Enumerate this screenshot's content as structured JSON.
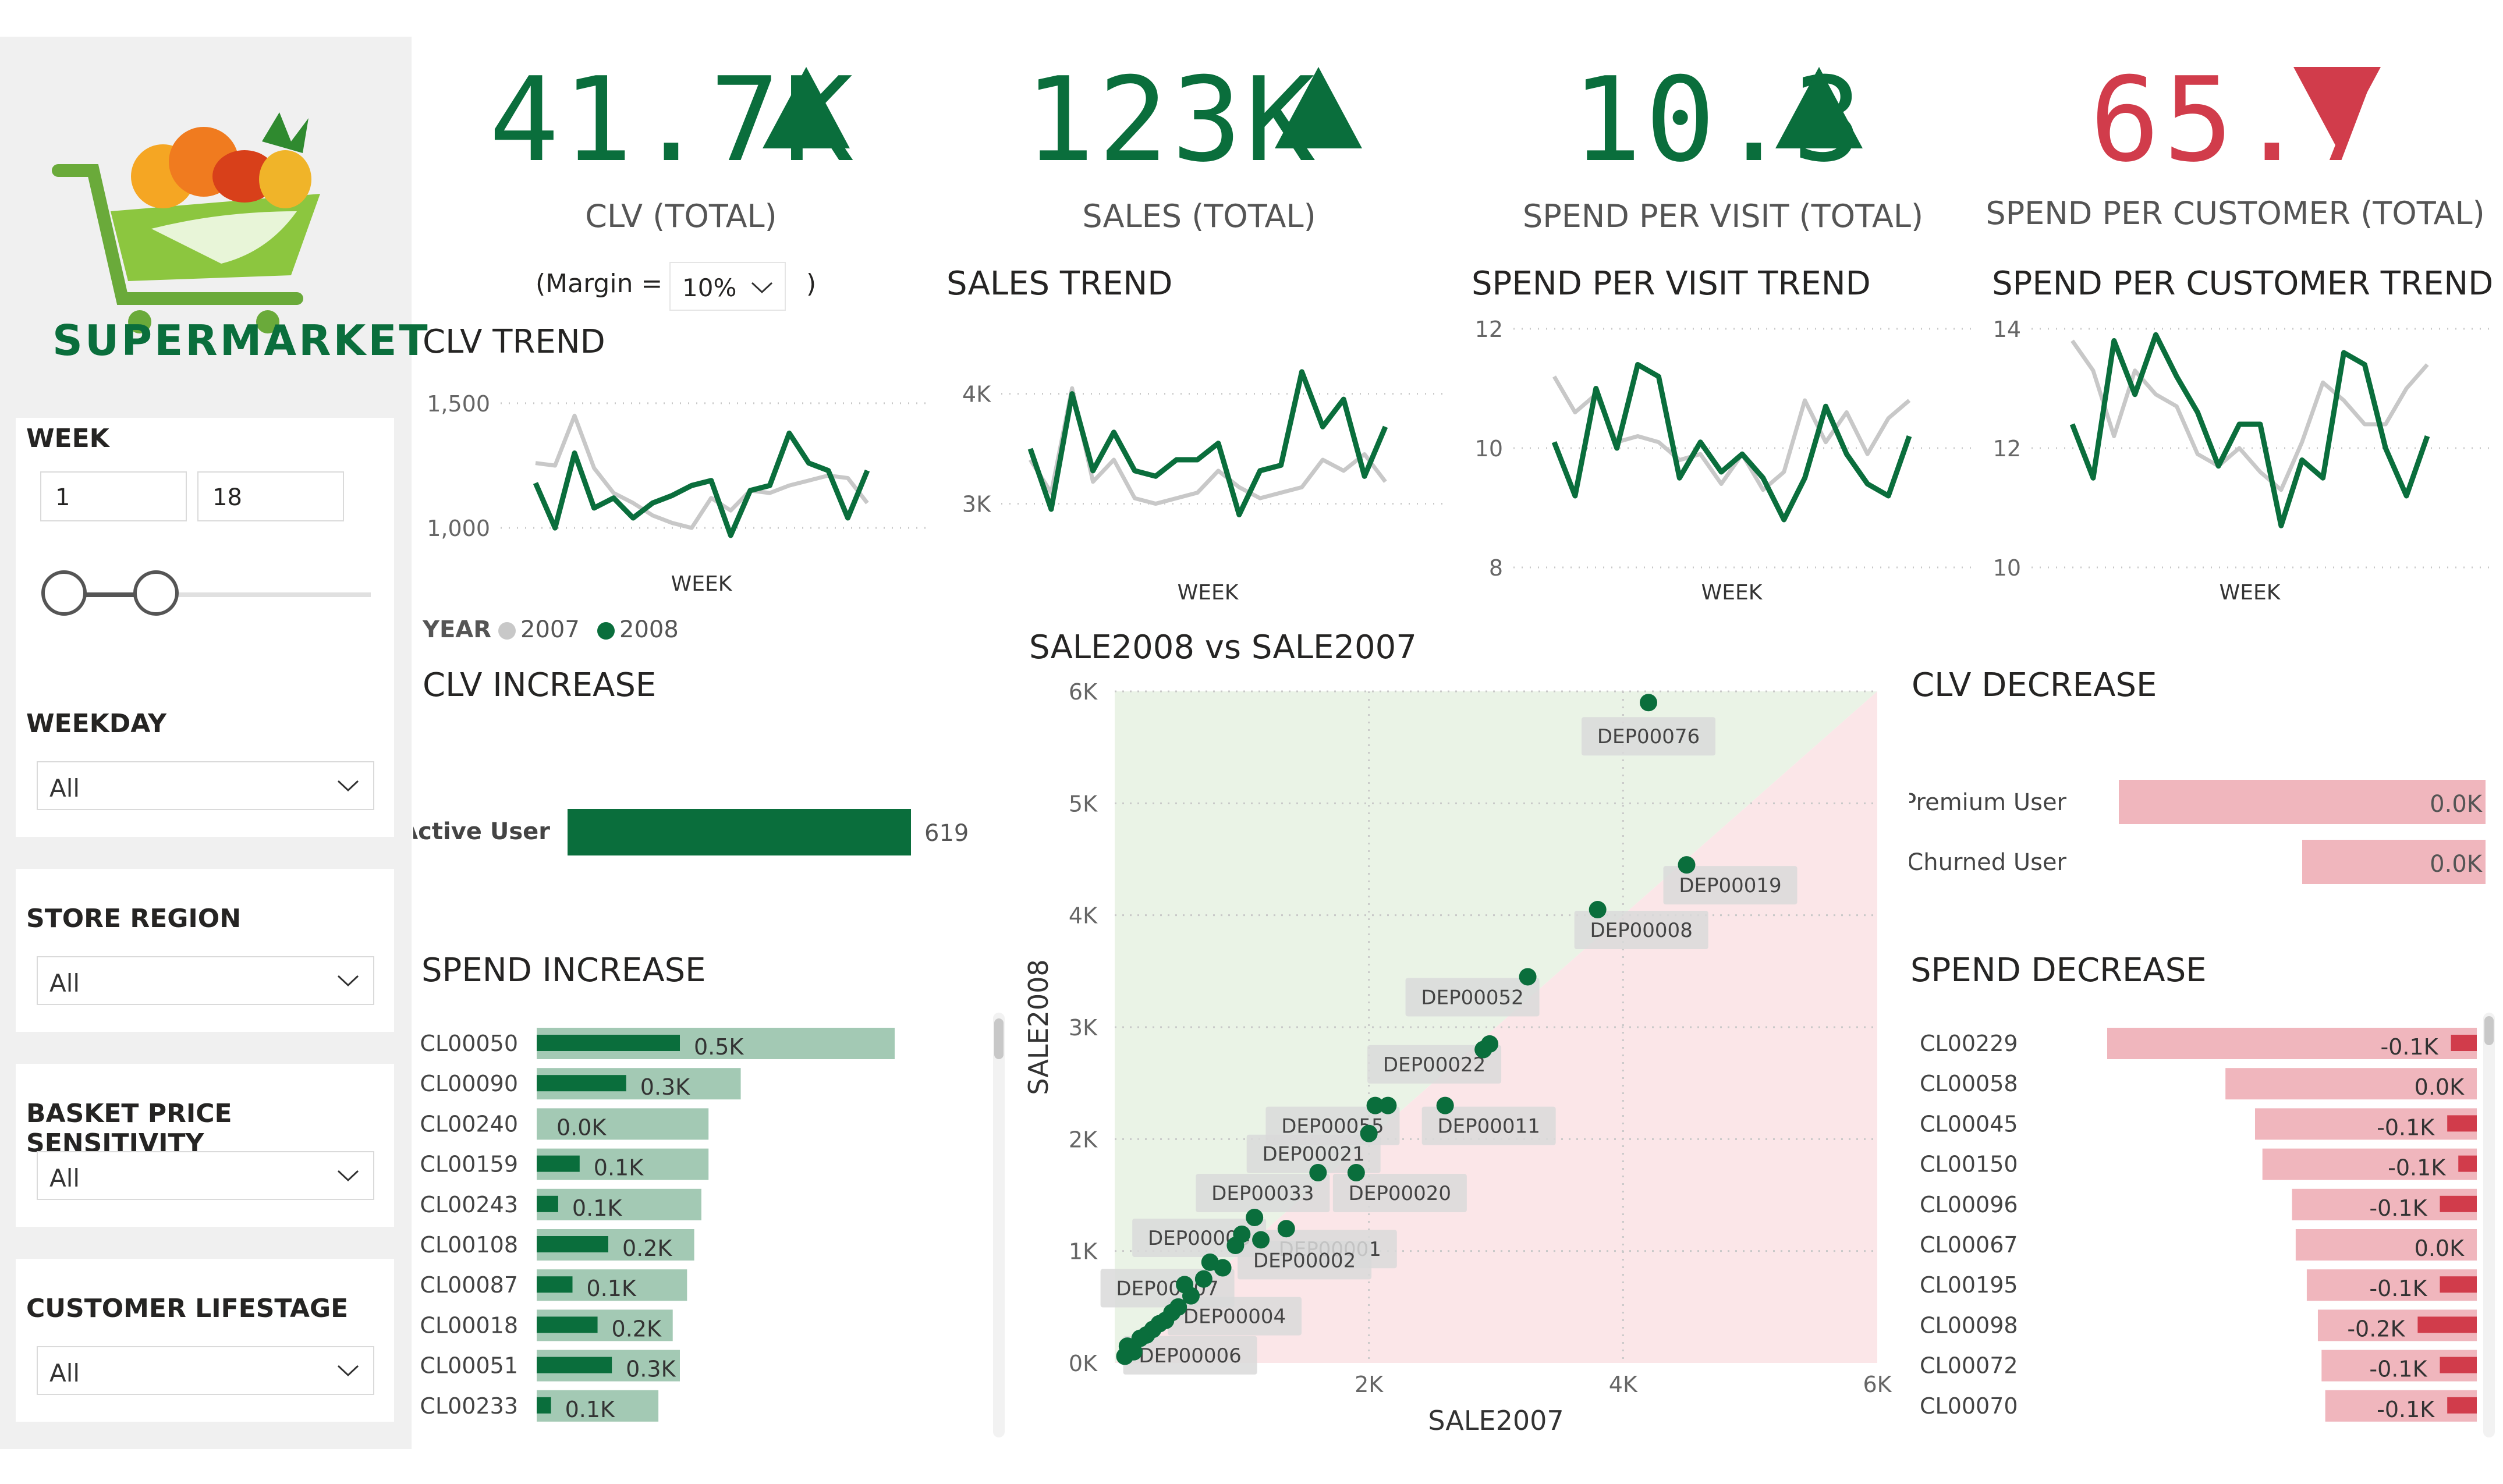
{
  "brand": {
    "name": "SUPERMARKET"
  },
  "filters": {
    "week": {
      "label": "WEEK",
      "from": "1",
      "to": "18"
    },
    "weekday": {
      "label": "WEEKDAY",
      "value": "All"
    },
    "store_region": {
      "label": "STORE REGION",
      "value": "All"
    },
    "basket_price_sensitivity": {
      "label": "BASKET PRICE SENSITIVITY",
      "value": "All"
    },
    "customer_lifestage": {
      "label": "CUSTOMER LIFESTAGE",
      "value": "All"
    }
  },
  "kpis": [
    {
      "value": "41.7K",
      "label": "CLV (TOTAL)",
      "trend": "up",
      "color": "#0a6e3c"
    },
    {
      "value": "123K",
      "label": "SALES (TOTAL)",
      "trend": "up",
      "color": "#0a6e3c"
    },
    {
      "value": "10.3",
      "label": "SPEND PER VISIT (TOTAL)",
      "trend": "up",
      "color": "#0a6e3c"
    },
    {
      "value": "65.7",
      "label": "SPEND PER CUSTOMER (TOTAL)",
      "trend": "down",
      "color": "#d13c4b"
    }
  ],
  "margin": {
    "prefix": "(Margin =",
    "value": "10%",
    "suffix": ")"
  },
  "legend": {
    "title": "YEAR",
    "items": [
      "2007",
      "2008"
    ]
  },
  "colors": {
    "y2007": "#c8c8c8",
    "y2008": "#0a6e3c",
    "pos_bg": "#a3c9b4",
    "neg_bar": "#f0b6bd",
    "neg_dark": "#d13c4b"
  },
  "chart_data": [
    {
      "type": "line",
      "title": "CLV TREND",
      "xlabel": "WEEK",
      "ylabel": "",
      "x": [
        1,
        2,
        3,
        4,
        5,
        6,
        7,
        8,
        9,
        10,
        11,
        12,
        13,
        14,
        15,
        16,
        17,
        18
      ],
      "ylim": [
        900,
        1600
      ],
      "yticks": [
        "1,000",
        "1,500"
      ],
      "series": [
        {
          "name": "2007",
          "values": [
            1260,
            1250,
            1450,
            1240,
            1140,
            1100,
            1050,
            1020,
            1000,
            1120,
            1070,
            1150,
            1140,
            1170,
            1190,
            1210,
            1200,
            1100
          ]
        },
        {
          "name": "2008",
          "values": [
            1180,
            1000,
            1300,
            1080,
            1120,
            1040,
            1100,
            1130,
            1170,
            1190,
            970,
            1150,
            1170,
            1380,
            1260,
            1230,
            1040,
            1230
          ]
        }
      ]
    },
    {
      "type": "line",
      "title": "SALES TREND",
      "xlabel": "WEEK",
      "ylabel": "",
      "x": [
        1,
        2,
        3,
        4,
        5,
        6,
        7,
        8,
        9,
        10,
        11,
        12,
        13,
        14,
        15,
        16,
        17,
        18
      ],
      "ylim": [
        2500,
        4300
      ],
      "yticks": [
        "3K",
        "4K"
      ],
      "series": [
        {
          "name": "2007",
          "values": [
            3400,
            3100,
            4050,
            3200,
            3400,
            3050,
            3000,
            3050,
            3100,
            3300,
            3150,
            3050,
            3100,
            3150,
            3400,
            3300,
            3450,
            3200
          ]
        },
        {
          "name": "2008",
          "values": [
            3500,
            2950,
            4000,
            3300,
            3650,
            3300,
            3250,
            3400,
            3400,
            3550,
            2900,
            3300,
            3350,
            4200,
            3700,
            3950,
            3250,
            3700
          ]
        }
      ]
    },
    {
      "type": "line",
      "title": "SPEND PER VISIT TREND",
      "xlabel": "WEEK",
      "ylabel": "",
      "x": [
        1,
        2,
        3,
        4,
        5,
        6,
        7,
        8,
        9,
        10,
        11,
        12,
        13,
        14,
        15,
        16,
        17,
        18
      ],
      "ylim": [
        8,
        12
      ],
      "yticks": [
        "8",
        "10",
        "12"
      ],
      "series": [
        {
          "name": "2007",
          "values": [
            11.2,
            10.6,
            10.9,
            10.1,
            10.2,
            10.1,
            9.8,
            9.9,
            9.4,
            9.9,
            9.3,
            9.6,
            10.8,
            10.1,
            10.6,
            9.9,
            10.5,
            10.8
          ]
        },
        {
          "name": "2008",
          "values": [
            10.1,
            9.2,
            11.0,
            10.0,
            11.4,
            11.2,
            9.5,
            10.1,
            9.6,
            9.9,
            9.5,
            8.8,
            9.5,
            10.7,
            9.9,
            9.4,
            9.2,
            10.2
          ]
        }
      ]
    },
    {
      "type": "line",
      "title": "SPEND PER CUSTOMER TREND",
      "xlabel": "WEEK",
      "ylabel": "",
      "x": [
        1,
        2,
        3,
        4,
        5,
        6,
        7,
        8,
        9,
        10,
        11,
        12,
        13,
        14,
        15,
        16,
        17,
        18
      ],
      "ylim": [
        10,
        14
      ],
      "yticks": [
        "10",
        "12",
        "14"
      ],
      "series": [
        {
          "name": "2007",
          "values": [
            13.8,
            13.3,
            12.2,
            13.3,
            12.9,
            12.7,
            11.9,
            11.7,
            12.0,
            11.6,
            11.3,
            12.1,
            13.1,
            12.8,
            12.4,
            12.4,
            13.0,
            13.4
          ]
        },
        {
          "name": "2008",
          "values": [
            12.4,
            11.5,
            13.8,
            12.9,
            13.9,
            13.2,
            12.6,
            11.7,
            12.4,
            12.4,
            10.7,
            11.8,
            11.5,
            13.6,
            13.4,
            12.0,
            11.2,
            12.2
          ]
        }
      ]
    },
    {
      "type": "bar",
      "title": "CLV INCREASE",
      "categories": [
        "Active User"
      ],
      "values": [
        619
      ],
      "labels": [
        "619"
      ]
    },
    {
      "type": "bar",
      "title": "CLV DECREASE",
      "categories": [
        "Premium User",
        "Churned User"
      ],
      "values": [
        0.0,
        0.0
      ],
      "labels": [
        "0.0K",
        "0.0K"
      ],
      "bar_extent": [
        1.0,
        0.5
      ]
    },
    {
      "type": "bar",
      "title": "SPEND INCREASE",
      "categories": [
        "CL00050",
        "CL00090",
        "CL00240",
        "CL00159",
        "CL00243",
        "CL00108",
        "CL00087",
        "CL00018",
        "CL00051",
        "CL00233"
      ],
      "series": [
        {
          "name": "",
          "values": [
            0.5,
            0.3,
            0.0,
            0.1,
            0.1,
            0.2,
            0.1,
            0.2,
            0.3,
            0.1
          ]
        }
      ],
      "labels": [
        "0.5K",
        "0.3K",
        "0.0K",
        "0.1K",
        "0.1K",
        "0.2K",
        "0.1K",
        "0.2K",
        "0.3K",
        "0.1K"
      ],
      "background": [
        1.0,
        0.57,
        0.48,
        0.48,
        0.46,
        0.44,
        0.42,
        0.38,
        0.4,
        0.34
      ],
      "foreground": [
        0.4,
        0.25,
        0.0,
        0.12,
        0.06,
        0.2,
        0.1,
        0.17,
        0.21,
        0.04
      ]
    },
    {
      "type": "bar",
      "title": "SPEND DECREASE",
      "categories": [
        "CL00229",
        "CL00058",
        "CL00045",
        "CL00150",
        "CL00096",
        "CL00067",
        "CL00195",
        "CL00098",
        "CL00072",
        "CL00070"
      ],
      "series": [
        {
          "name": "",
          "values": [
            -0.1,
            0.0,
            -0.1,
            -0.1,
            -0.1,
            0.0,
            -0.1,
            -0.2,
            -0.1,
            -0.1
          ]
        }
      ],
      "labels": [
        "-0.1K",
        "0.0K",
        "-0.1K",
        "-0.1K",
        "-0.1K",
        "0.0K",
        "-0.1K",
        "-0.2K",
        "-0.1K",
        "-0.1K"
      ],
      "background": [
        1.0,
        0.68,
        0.6,
        0.58,
        0.5,
        0.49,
        0.46,
        0.43,
        0.42,
        0.41
      ],
      "foreground": [
        0.07,
        0.0,
        0.08,
        0.05,
        0.1,
        0.0,
        0.1,
        0.16,
        0.1,
        0.08
      ]
    },
    {
      "type": "scatter",
      "title": "SALE2008 vs SALE2007",
      "xlabel": "SALE2007",
      "ylabel": "SALE2008",
      "xlim": [
        0,
        6000
      ],
      "ylim": [
        0,
        6000
      ],
      "xticks": [
        "2K",
        "4K",
        "6K"
      ],
      "yticks": [
        "0K",
        "1K",
        "2K",
        "3K",
        "4K",
        "5K",
        "6K"
      ],
      "points": [
        {
          "x": 4200,
          "y": 5900,
          "label": "DEP00076"
        },
        {
          "x": 4500,
          "y": 4450,
          "label": "DEP00019"
        },
        {
          "x": 3800,
          "y": 4050,
          "label": "DEP00008"
        },
        {
          "x": 3250,
          "y": 3450,
          "label": "DEP00052"
        },
        {
          "x": 2950,
          "y": 2850,
          "label": "DEP00022"
        },
        {
          "x": 2900,
          "y": 2800,
          "label": ""
        },
        {
          "x": 2600,
          "y": 2300,
          "label": "DEP00011"
        },
        {
          "x": 2150,
          "y": 2300,
          "label": "DEP00055"
        },
        {
          "x": 2050,
          "y": 2300,
          "label": ""
        },
        {
          "x": 2000,
          "y": 2050,
          "label": "DEP00021"
        },
        {
          "x": 1900,
          "y": 1700,
          "label": "DEP00020"
        },
        {
          "x": 1600,
          "y": 1700,
          "label": "DEP00033"
        },
        {
          "x": 1350,
          "y": 1200,
          "label": "DEP00001"
        },
        {
          "x": 1100,
          "y": 1300,
          "label": "DEP00003"
        },
        {
          "x": 1150,
          "y": 1100,
          "label": "DEP00002"
        },
        {
          "x": 950,
          "y": 1050,
          "label": ""
        },
        {
          "x": 1000,
          "y": 1150,
          "label": ""
        },
        {
          "x": 850,
          "y": 850,
          "label": "DEP00007"
        },
        {
          "x": 750,
          "y": 900,
          "label": ""
        },
        {
          "x": 700,
          "y": 750,
          "label": ""
        },
        {
          "x": 600,
          "y": 600,
          "label": "DEP00004"
        },
        {
          "x": 550,
          "y": 700,
          "label": ""
        },
        {
          "x": 500,
          "y": 500,
          "label": ""
        },
        {
          "x": 450,
          "y": 450,
          "label": ""
        },
        {
          "x": 400,
          "y": 380,
          "label": ""
        },
        {
          "x": 350,
          "y": 350,
          "label": ""
        },
        {
          "x": 300,
          "y": 300,
          "label": ""
        },
        {
          "x": 250,
          "y": 250,
          "label": "DEP00006"
        },
        {
          "x": 200,
          "y": 220,
          "label": ""
        },
        {
          "x": 150,
          "y": 100,
          "label": ""
        },
        {
          "x": 100,
          "y": 150,
          "label": ""
        },
        {
          "x": 80,
          "y": 60,
          "label": ""
        }
      ]
    }
  ]
}
